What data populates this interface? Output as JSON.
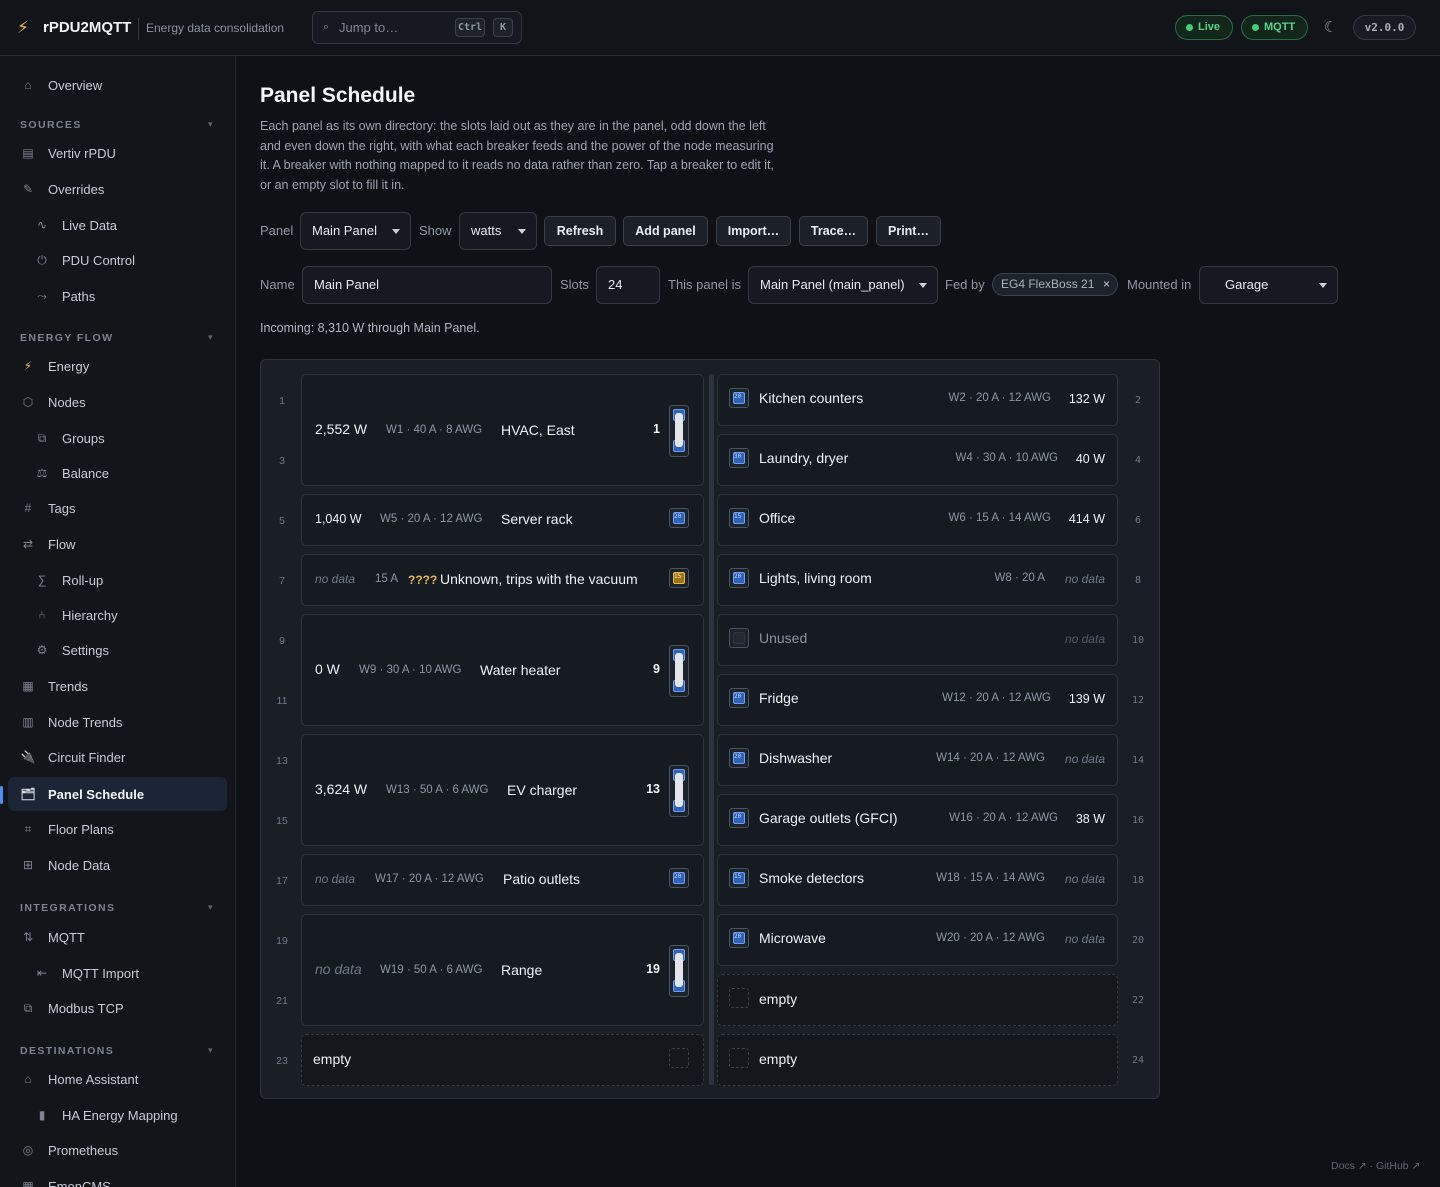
{
  "app": {
    "name": "rPDU2MQTT",
    "subtitle": "Energy data consolidation",
    "search_placeholder": "Jump to…",
    "shortcut_ctrl": "Ctrl",
    "shortcut_k": "K",
    "badge_live": "Live",
    "badge_mqtt": "MQTT",
    "version": "v2.0.0",
    "accent": "#4e8ef7"
  },
  "sidebar": {
    "overview": "Overview",
    "sections": {
      "sources": "SOURCES",
      "energy_flow": "ENERGY FLOW",
      "integrations": "INTEGRATIONS",
      "destinations": "DESTINATIONS"
    },
    "items": {
      "vertiv": "Vertiv rPDU",
      "overrides": "Overrides",
      "live_data": "Live Data",
      "pdu_control": "PDU Control",
      "paths": "Paths",
      "energy": "Energy",
      "nodes": "Nodes",
      "groups": "Groups",
      "balance": "Balance",
      "tags": "Tags",
      "flow": "Flow",
      "rollup": "Roll-up",
      "hierarchy": "Hierarchy",
      "settings": "Settings",
      "trends": "Trends",
      "node_trends": "Node Trends",
      "circuit_finder": "Circuit Finder",
      "panel_schedule": "Panel Schedule",
      "floor_plans": "Floor Plans",
      "node_data": "Node Data",
      "mqtt": "MQTT",
      "mqtt_import": "MQTT Import",
      "modbus": "Modbus TCP",
      "home_assistant": "Home Assistant",
      "ha_energy": "HA Energy Mapping",
      "prometheus": "Prometheus",
      "emoncms": "EmonCMS"
    }
  },
  "page": {
    "title": "Panel Schedule",
    "description": "Each panel as its own directory: the slots laid out as they are in the panel, odd down the left and even down the right, with what each breaker feeds and the power of the node measuring it. A breaker with nothing mapped to it reads no data rather than zero. Tap a breaker to edit it, or an empty slot to fill it in.",
    "controls": {
      "panel_label": "Panel",
      "panel_value": "Main Panel",
      "show_label": "Show",
      "show_value": "watts",
      "refresh": "Refresh",
      "add_panel": "Add panel",
      "import": "Import…",
      "trace": "Trace…",
      "print": "Print…"
    },
    "form": {
      "name_label": "Name",
      "name_value": "Main Panel",
      "slots_label": "Slots",
      "slots_value": "24",
      "this_panel_label": "This panel is",
      "this_panel_value": "Main Panel (main_panel)",
      "fed_by_label": "Fed by",
      "fed_by_chip": "EG4 FlexBoss 21",
      "chip_close": "×",
      "mounted_label": "Mounted in",
      "mounted_value": "Garage"
    },
    "incoming": "Incoming: 8,310 W through Main Panel.",
    "footer": "Docs ↗ · GitHub ↗"
  },
  "schedule": {
    "slot_numbers": [
      "1",
      "2",
      "3",
      "4",
      "5",
      "6",
      "7",
      "8",
      "9",
      "10",
      "11",
      "12",
      "13",
      "14",
      "15",
      "16",
      "17",
      "18",
      "19",
      "20",
      "21",
      "22",
      "23",
      "24"
    ],
    "left": [
      {
        "watts": "2,552 W",
        "meta": "W1 · 40 A · 8 AWG",
        "name": "HVAC, East",
        "pos": "1",
        "amps": [
          40,
          40
        ]
      },
      {
        "watts": "1,040 W",
        "meta": "W5 · 20 A · 12 AWG",
        "name": "Server rack",
        "amps": 20
      },
      {
        "watts": "no data",
        "meta": "15 A",
        "warn": "????",
        "name": "Unknown, trips with the vacuum",
        "amps": 15
      },
      {
        "watts": "0 W",
        "meta": "W9 · 30 A · 10 AWG",
        "name": "Water heater",
        "pos": "9",
        "amps": [
          30,
          30
        ]
      },
      {
        "watts": "3,624 W",
        "meta": "W13 · 50 A · 6 AWG",
        "name": "EV charger",
        "pos": "13",
        "amps": [
          50,
          50
        ]
      },
      {
        "watts": "no data",
        "meta": "W17 · 20 A · 12 AWG",
        "name": "Patio outlets",
        "amps": 20
      },
      {
        "watts": "no data",
        "meta": "W19 · 50 A · 6 AWG",
        "name": "Range",
        "pos": "19",
        "amps": [
          50,
          50
        ]
      },
      {
        "name": "empty"
      }
    ],
    "right": [
      {
        "name": "Kitchen counters",
        "meta": "W2 · 20 A · 12 AWG",
        "watts": "132 W",
        "amps": 20
      },
      {
        "name": "Laundry, dryer",
        "meta": "W4 · 30 A · 10 AWG",
        "watts": "40 W",
        "amps": 30
      },
      {
        "name": "Office",
        "meta": "W6 · 15 A · 14 AWG",
        "watts": "414 W",
        "amps": 15
      },
      {
        "name": "Lights, living room",
        "meta": "W8 · 20 A",
        "watts": "no data",
        "amps": 20
      },
      {
        "name": "Unused",
        "watts": "no data"
      },
      {
        "name": "Fridge",
        "meta": "W12 · 20 A · 12 AWG",
        "watts": "139 W",
        "amps": 20
      },
      {
        "name": "Dishwasher",
        "meta": "W14 · 20 A · 12 AWG",
        "watts": "no data",
        "amps": 20
      },
      {
        "name": "Garage outlets (GFCI)",
        "meta": "W16 · 20 A · 12 AWG",
        "watts": "38 W",
        "amps": 20
      },
      {
        "name": "Smoke detectors",
        "meta": "W18 · 15 A · 14 AWG",
        "watts": "no data",
        "amps": 15
      },
      {
        "name": "Microwave",
        "meta": "W20 · 20 A · 12 AWG",
        "watts": "no data",
        "amps": 20
      },
      {
        "name": "empty"
      },
      {
        "name": "empty"
      }
    ]
  }
}
